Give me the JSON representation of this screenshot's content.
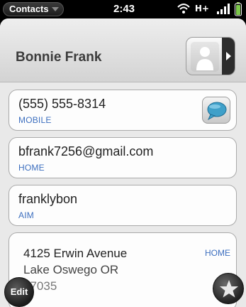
{
  "status_bar": {
    "app_menu_label": "Contacts",
    "time": "2:43",
    "network": "H+"
  },
  "header": {
    "contact_name": "Bonnie Frank"
  },
  "fields": [
    {
      "value": "(555) 555-8314",
      "label": "MOBILE"
    },
    {
      "value": "bfrank7256@gmail.com",
      "label": "HOME"
    },
    {
      "value": "franklybon",
      "label": "AIM"
    }
  ],
  "address": {
    "line1": "4125 Erwin Avenue",
    "line2": "Lake Oswego OR",
    "line3": "97035",
    "label": "HOME"
  },
  "buttons": {
    "edit_label": "Edit"
  },
  "colors": {
    "label_blue": "#3d6fbf",
    "chat_bubble": "#3fa0c9"
  }
}
